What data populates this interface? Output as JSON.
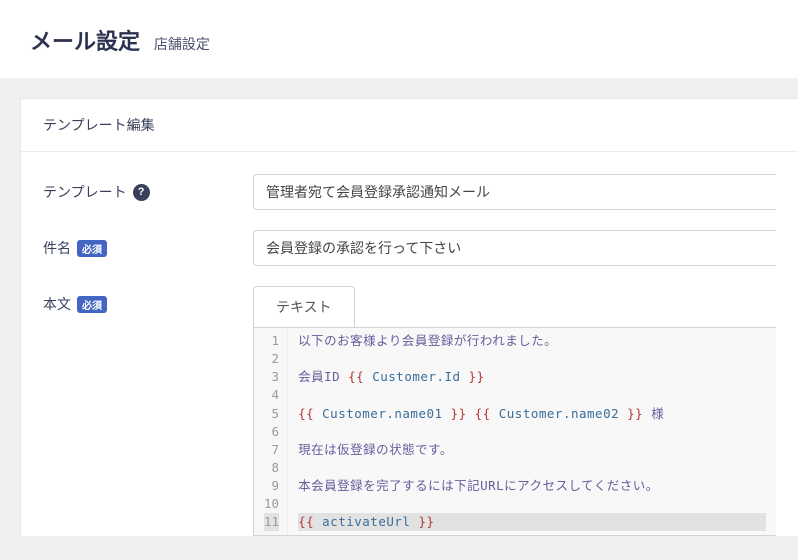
{
  "header": {
    "title": "メール設定",
    "subtitle": "店舗設定"
  },
  "panel": {
    "title": "テンプレート編集"
  },
  "form": {
    "template": {
      "label": "テンプレート",
      "value": "管理者宛て会員登録承認通知メール"
    },
    "subject": {
      "label": "件名",
      "required_text": "必須",
      "value": "会員登録の承認を行って下さい"
    },
    "body": {
      "label": "本文",
      "required_text": "必須",
      "tab_text": "テキスト"
    }
  },
  "editor": {
    "lines": [
      [
        {
          "t": "text",
          "v": "以下のお客様より会員登録が行われました。"
        }
      ],
      [],
      [
        {
          "t": "text",
          "v": "会員ID "
        },
        {
          "t": "delim",
          "v": "{{"
        },
        {
          "t": "var",
          "v": " Customer.Id "
        },
        {
          "t": "delim",
          "v": "}}"
        }
      ],
      [],
      [
        {
          "t": "delim",
          "v": "{{"
        },
        {
          "t": "var",
          "v": " Customer.name01 "
        },
        {
          "t": "delim",
          "v": "}}"
        },
        {
          "t": "text",
          "v": " "
        },
        {
          "t": "delim",
          "v": "{{"
        },
        {
          "t": "var",
          "v": " Customer.name02 "
        },
        {
          "t": "delim",
          "v": "}}"
        },
        {
          "t": "text",
          "v": " 様"
        }
      ],
      [],
      [
        {
          "t": "text",
          "v": "現在は仮登録の状態です。"
        }
      ],
      [],
      [
        {
          "t": "text",
          "v": "本会員登録を完了するには下記URLにアクセスしてください。"
        }
      ],
      [],
      [
        {
          "t": "delim",
          "v": "{{"
        },
        {
          "t": "var",
          "v": " activateUrl "
        },
        {
          "t": "delim",
          "v": "}}"
        }
      ]
    ],
    "active_line_index": 10
  }
}
